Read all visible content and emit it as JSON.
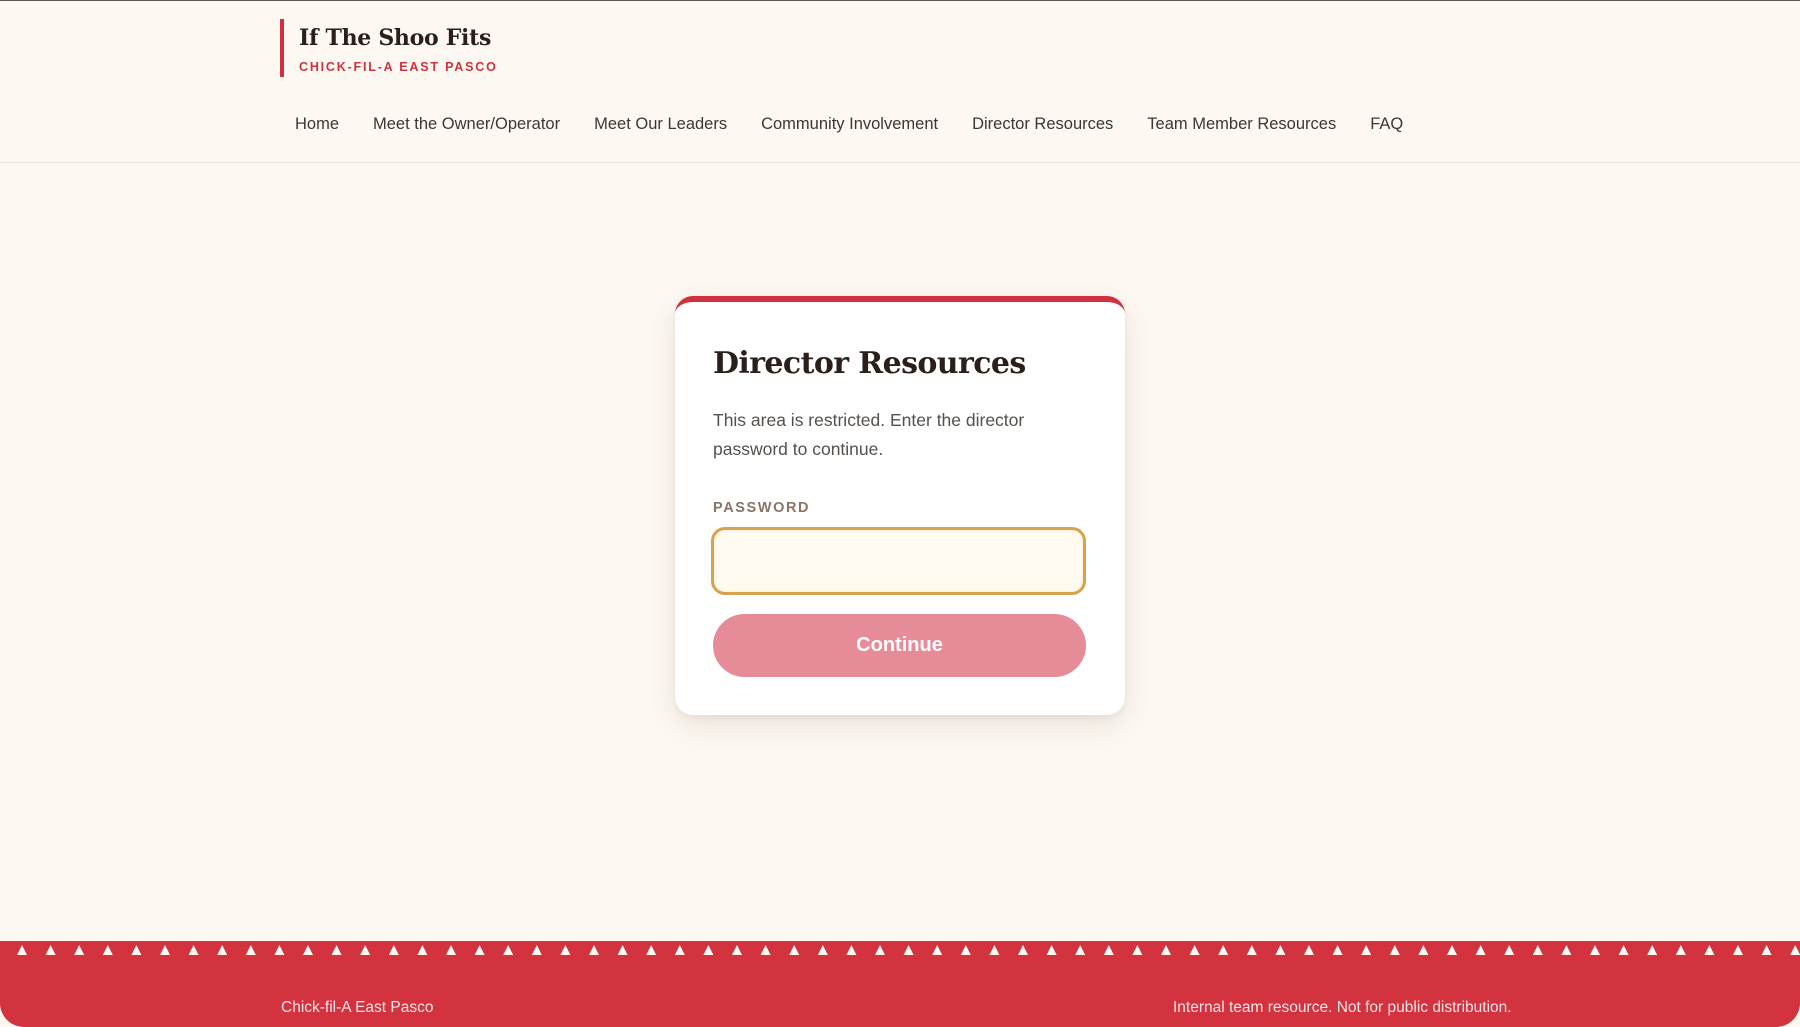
{
  "header": {
    "brand_title": "If The Shoo Fits",
    "brand_subtitle": "CHICK-FIL-A EAST PASCO",
    "nav": [
      {
        "label": "Home"
      },
      {
        "label": "Meet the Owner/Operator"
      },
      {
        "label": "Meet Our Leaders"
      },
      {
        "label": "Community Involvement"
      },
      {
        "label": "Director Resources"
      },
      {
        "label": "Team Member Resources"
      },
      {
        "label": "FAQ"
      }
    ]
  },
  "login_card": {
    "title": "Director Resources",
    "description": "This area is restricted. Enter the director password to continue.",
    "password_label": "PASSWORD",
    "password_value": "",
    "continue_label": "Continue"
  },
  "footer": {
    "left_text": "Chick-fil-A East Pasco",
    "right_text": "Internal team resource. Not for public distribution."
  },
  "colors": {
    "accent_red": "#d1303e",
    "button_disabled": "#e58c98",
    "input_focus_border": "#d6a24e",
    "page_background": "#fdf9f2"
  }
}
